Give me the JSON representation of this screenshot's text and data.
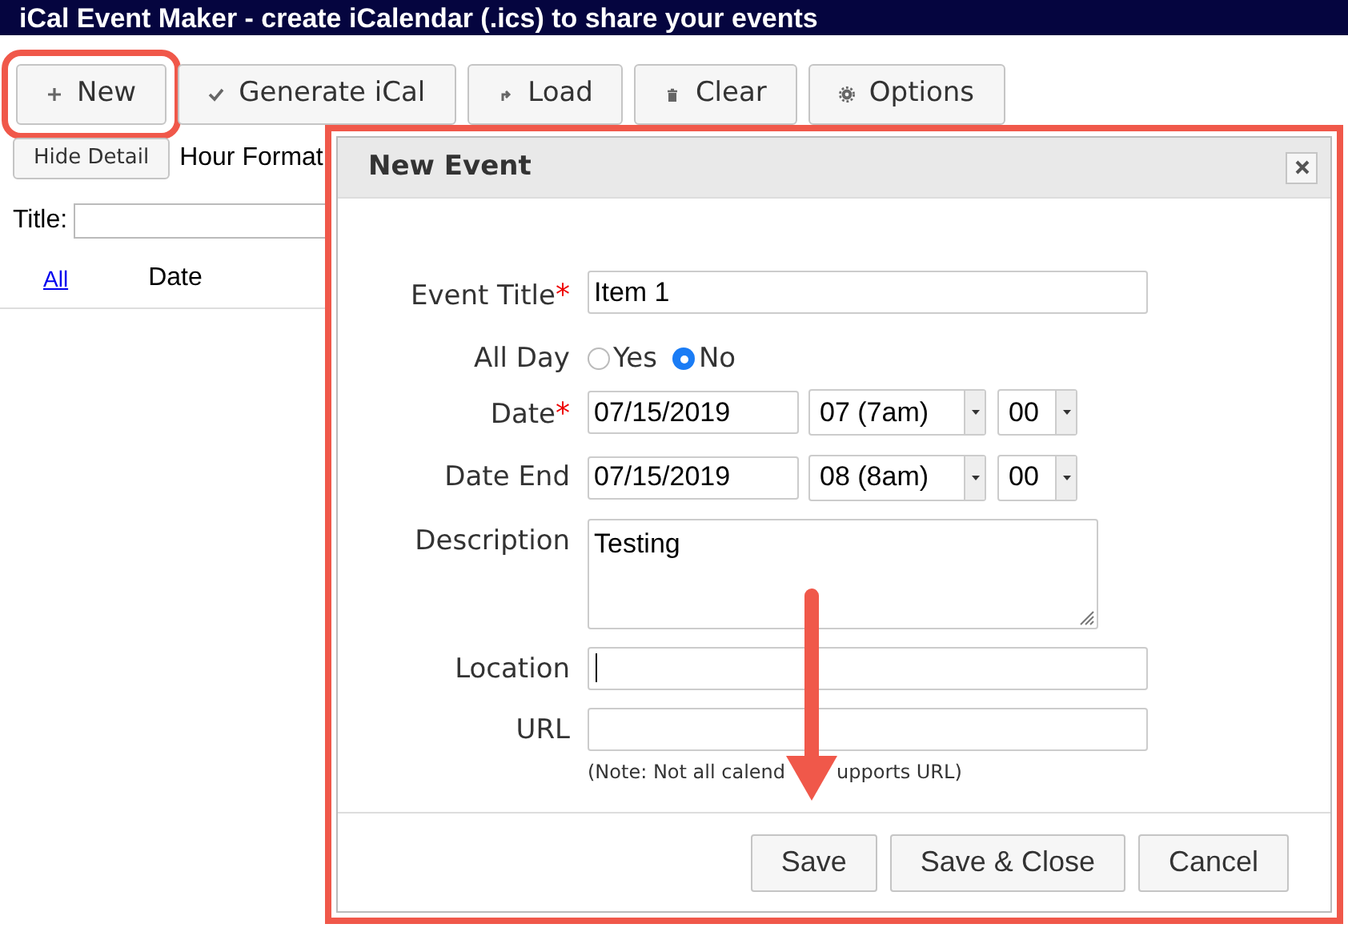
{
  "title": "iCal Event Maker - create iCalendar (.ics) to share your events",
  "toolbar": [
    {
      "kind": "plus",
      "label": "New",
      "highlighted": true
    },
    {
      "kind": "check",
      "label": "Generate iCal",
      "highlighted": false
    },
    {
      "kind": "load",
      "label": "Load",
      "highlighted": false
    },
    {
      "kind": "trash",
      "label": "Clear",
      "highlighted": false
    },
    {
      "kind": "gear",
      "label": "Options",
      "highlighted": false
    }
  ],
  "hide_detail_button": "Hide Detail",
  "hour_format_label": "Hour Format",
  "title_filter": {
    "label": "Title:"
  },
  "columns": [
    {
      "kind": "link",
      "label": "All"
    },
    {
      "kind": "text",
      "label": "Date"
    }
  ],
  "dialog": {
    "title": "New Event",
    "fields": [
      {
        "kind": "text",
        "label": "Event Title",
        "mark": "*",
        "value": "Item 1",
        "focused": false
      },
      {
        "kind": "radio",
        "label": "All Day",
        "options": [
          {
            "label": "Yes",
            "selected": false
          },
          {
            "label": "No",
            "selected": true
          }
        ]
      },
      {
        "kind": "datetime",
        "label": "Date",
        "mark": "*",
        "value": "07/15/2019",
        "hour": "07 (7am)",
        "minute": "00"
      },
      {
        "kind": "datetime",
        "label": "Date End",
        "value": "07/15/2019",
        "hour": "08 (8am)",
        "minute": "00"
      },
      {
        "kind": "textarea",
        "label": "Description",
        "value": "Testing"
      },
      {
        "kind": "text",
        "label": "Location",
        "focused": true
      },
      {
        "kind": "text",
        "label": "URL",
        "focused": false,
        "note": [
          "(Note: Not all calend",
          "upports URL)"
        ]
      }
    ],
    "buttons": [
      "Save",
      "Save & Close",
      "Cancel"
    ]
  }
}
